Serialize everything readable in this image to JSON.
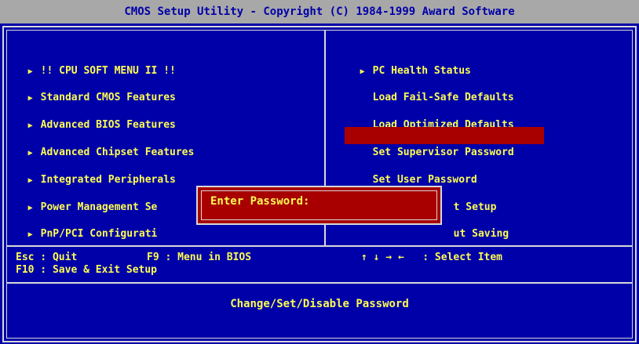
{
  "header": {
    "title": "CMOS Setup Utility - Copyright (C) 1984-1999 Award Software"
  },
  "menu_left": [
    {
      "label": "!! CPU SOFT MENU II !!",
      "arrow": "▶"
    },
    {
      "label": "Standard CMOS Features",
      "arrow": "▶"
    },
    {
      "label": "Advanced BIOS Features",
      "arrow": "▶"
    },
    {
      "label": "Advanced Chipset Features",
      "arrow": "▶"
    },
    {
      "label": "Integrated Peripherals",
      "arrow": "▶"
    },
    {
      "label": "Power Management Se",
      "arrow": "▶"
    },
    {
      "label": "PnP/PCI Configurati",
      "arrow": "▶"
    }
  ],
  "menu_right": [
    {
      "label": "PC Health Status",
      "arrow": "▶"
    },
    {
      "label": "Load Fail-Safe Defaults"
    },
    {
      "label": "Load Optimized Defaults"
    },
    {
      "label": "Set Supervisor Password"
    },
    {
      "label": "Set User Password"
    },
    {
      "label": "t Setup"
    },
    {
      "label": "ut Saving"
    }
  ],
  "dialog": {
    "label": "Enter Password:",
    "value": ""
  },
  "help": {
    "esc": "Esc : Quit",
    "f9": "F9 : Menu in BIOS",
    "arrows": "↑ ↓ → ←   : Select Item",
    "f10": "F10 : Save & Exit Setup"
  },
  "status": {
    "text": "Change/Set/Disable Password"
  },
  "colors": {
    "background": "#0000a8",
    "text": "#fcfc54",
    "highlight": "#a80000",
    "titlebar": "#a8a8a8"
  }
}
